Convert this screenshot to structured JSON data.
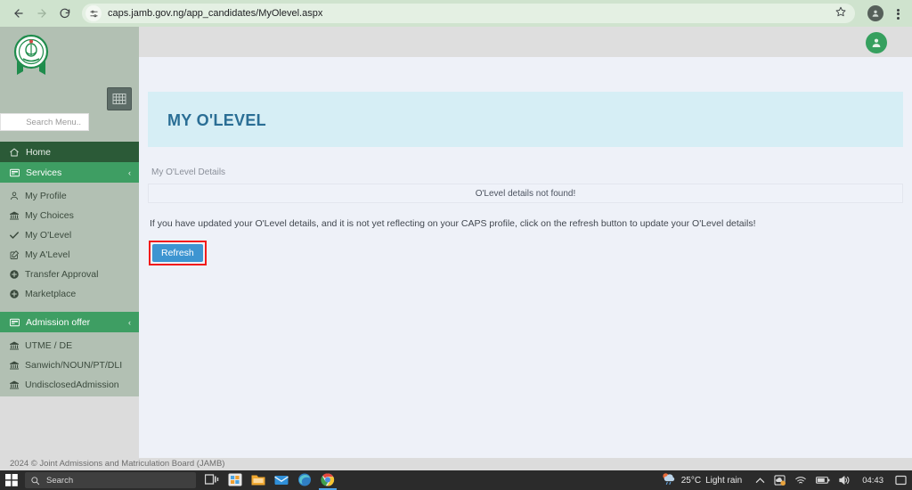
{
  "browser": {
    "url": "caps.jamb.gov.ng/app_candidates/MyOlevel.aspx",
    "back_icon": "back-arrow-icon",
    "forward_icon": "forward-arrow-icon",
    "reload_icon": "reload-icon",
    "site_settings_icon": "tune-icon",
    "bookmark_icon": "star-icon",
    "profile_icon": "profile-avatar-icon",
    "menu_icon": "three-dot-menu-icon"
  },
  "app": {
    "logo_alt": "jamb-logo",
    "avatar_alt": "user-avatar-icon",
    "grid_toggle_alt": "grid-menu-icon"
  },
  "sidebar": {
    "search": {
      "placeholder": "Search Menu..",
      "value": ""
    },
    "home": {
      "label": "Home",
      "icon": "home-icon"
    },
    "services": {
      "label": "Services",
      "icon": "services-card-icon",
      "caret": "‹"
    },
    "service_items": [
      {
        "label": "My Profile",
        "icon": "user-icon"
      },
      {
        "label": "My Choices",
        "icon": "bank-icon"
      },
      {
        "label": "My O'Level",
        "icon": "check-icon"
      },
      {
        "label": "My A'Level",
        "icon": "edit-square-icon"
      },
      {
        "label": "Transfer Approval",
        "icon": "circle-plus-icon"
      },
      {
        "label": "Marketplace",
        "icon": "circle-plus-icon"
      }
    ],
    "admission": {
      "label": "Admission offer",
      "icon": "services-card-icon",
      "caret": "‹"
    },
    "admission_items": [
      {
        "label": "UTME / DE",
        "icon": "bank-icon"
      },
      {
        "label": "Sanwich/NOUN/PT/DLI",
        "icon": "bank-icon"
      },
      {
        "label": "UndisclosedAdmission",
        "icon": "bank-icon"
      }
    ]
  },
  "main": {
    "page_title": "MY O'LEVEL",
    "breadcrumb": "My O'Level Details",
    "alert_text": "O'Level details not found!",
    "info_text": "If you have updated your O'Level details, and it is not yet reflecting on your CAPS profile, click on the refresh button to update your O'Level details!",
    "refresh_label": "Refresh",
    "highlight_color": "#f21b1b",
    "refresh_color": "#3d95d1",
    "banner_color": "#d6eef5",
    "title_color": "#2a6e95"
  },
  "footer": {
    "text": "2024 © Joint Admissions and Matriculation Board (JAMB)"
  },
  "taskbar": {
    "start_icon": "windows-start-icon",
    "search_placeholder": "Search",
    "search_icon": "search-icon",
    "icons": [
      {
        "name": "task-view-icon"
      },
      {
        "name": "microsoft-store-icon"
      },
      {
        "name": "file-explorer-icon"
      },
      {
        "name": "mail-icon"
      },
      {
        "name": "edge-browser-icon"
      },
      {
        "name": "chrome-browser-icon"
      }
    ],
    "weather": {
      "temperature": "25°C",
      "condition": "Light rain",
      "icon": "rain-cloud-icon"
    },
    "tray": {
      "chevron": "^",
      "items": [
        "onedrive-icon",
        "wifi-icon",
        "battery-icon",
        "volume-icon"
      ],
      "clock": "04:43",
      "notification_icon": "notification-icon"
    }
  }
}
